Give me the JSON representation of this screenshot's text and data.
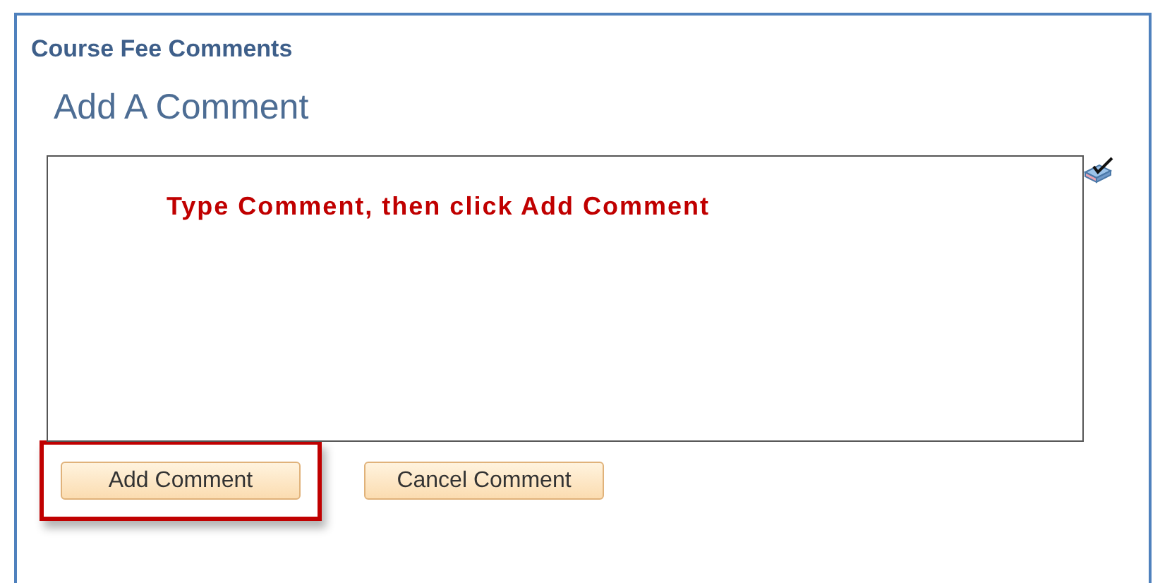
{
  "panel": {
    "title": "Course Fee Comments"
  },
  "heading": "Add A Comment",
  "comment_box": {
    "annotation": "Type Comment, then click Add Comment"
  },
  "buttons": [
    {
      "label": "Add Comment",
      "highlighted": true
    },
    {
      "label": "Cancel Comment",
      "highlighted": false
    }
  ]
}
